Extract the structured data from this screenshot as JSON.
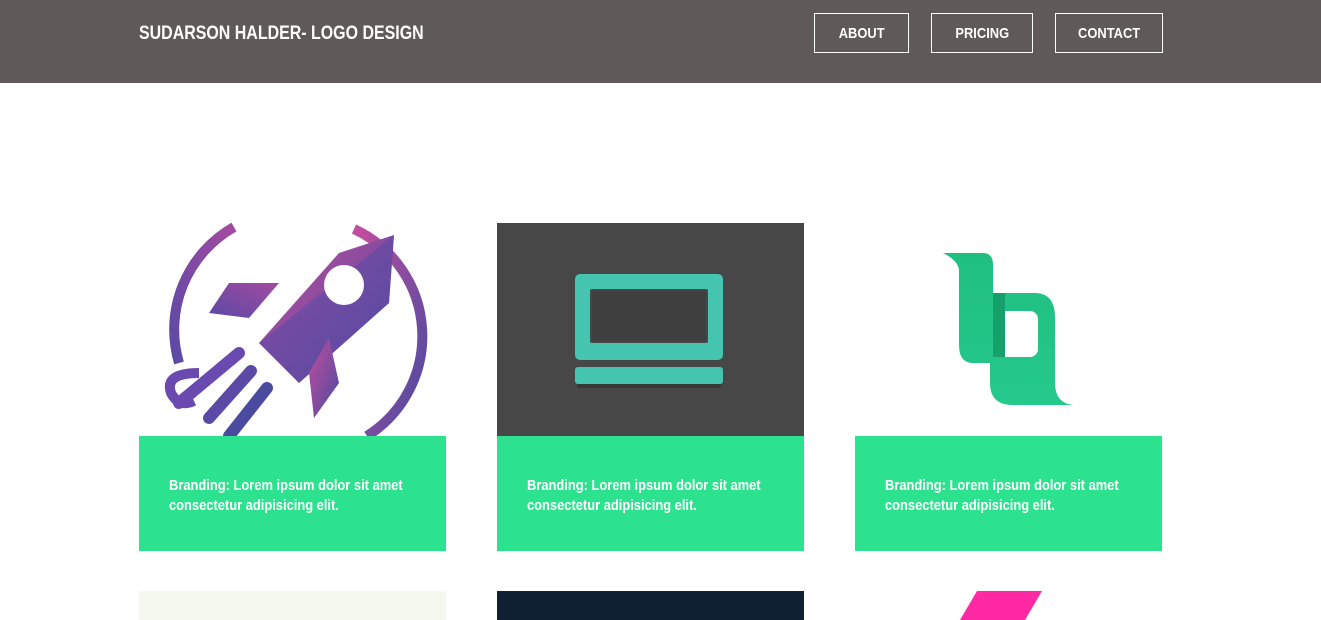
{
  "header": {
    "brand": "SUDARSON HALDER- LOGO DESIGN",
    "nav": [
      {
        "label": "ABOUT"
      },
      {
        "label": "PRICING"
      },
      {
        "label": "CONTACT"
      }
    ],
    "background_color": "#5f5a59"
  },
  "portfolio": {
    "accent_color": "#2ce28f",
    "cards": [
      {
        "image": "rocket-logo",
        "caption_line1": "Branding: Lorem ipsum dolor sit amet",
        "caption_line2": "consectetur adipisicing elit."
      },
      {
        "image": "laptop-logo",
        "caption_line1": "Branding: Lorem ipsum dolor sit amet",
        "caption_line2": "consectetur adipisicing elit."
      },
      {
        "image": "bq-ribbon-logo",
        "caption_line1": "Branding: Lorem ipsum dolor sit amet",
        "caption_line2": "consectetur adipisicing elit."
      }
    ],
    "next_row_thumbnails": [
      {
        "image": "light-thumbnail"
      },
      {
        "image": "dark-navy-thumbnail"
      },
      {
        "image": "pink-stripe-thumbnail"
      }
    ]
  }
}
